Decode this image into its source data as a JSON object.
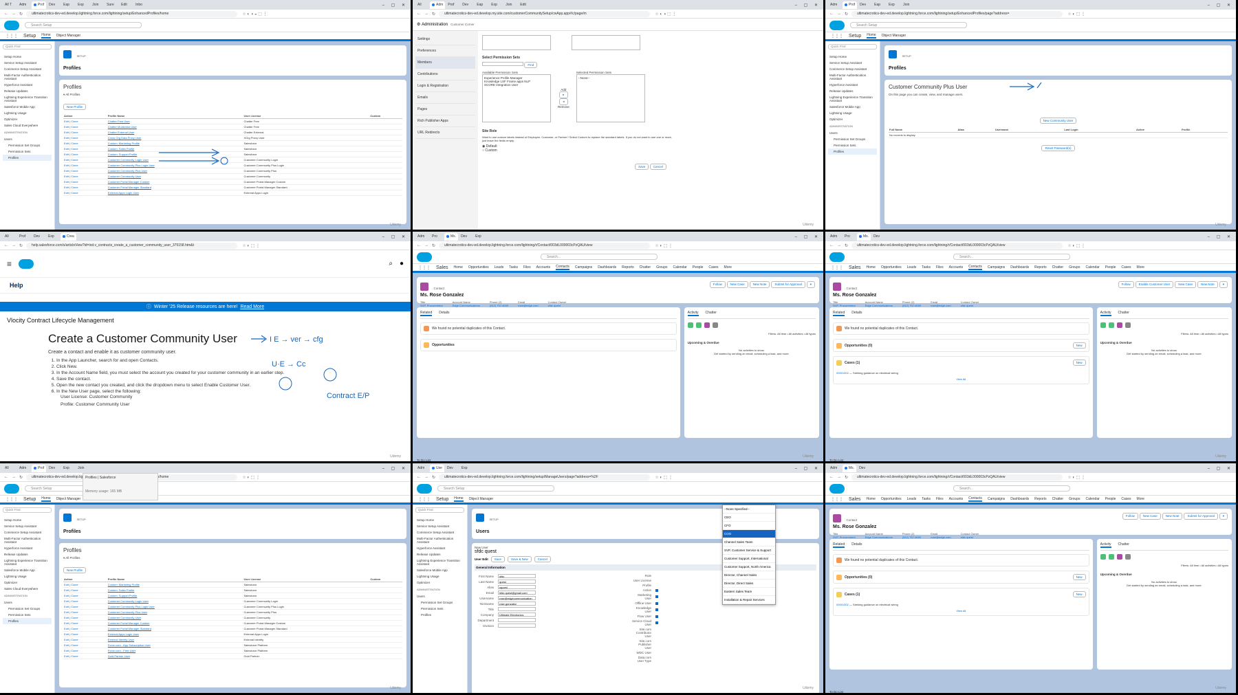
{
  "watermark": "Udemy",
  "cells": {
    "c1": {
      "url": "ultimatecrotics-dev-ed.develop.lightning.force.com/lightning/setup/EnhancedProfiles/home",
      "app": "Setup",
      "nav_home": "Home",
      "nav_object_manager": "Object Manager",
      "search_placeholder": "Search Setup",
      "quick_find": "Quick Find",
      "sidebar": [
        "Setup Home",
        "Service Setup Assistant",
        "Commerce Setup Assistant",
        "Multi-Factor Authentication Assistant",
        "Hyperforce Assistant",
        "Release Updates",
        "Lightning Experience Transition Assistant",
        "Salesforce Mobile App",
        "Lightning Usage",
        "Optimizer",
        "Sales Cloud Everywhere"
      ],
      "admin_heading": "ADMINISTRATION",
      "users_label": "Users",
      "sub_items": [
        "Permission Set Groups",
        "Permission Sets",
        "Profiles"
      ],
      "header_small": "SETUP",
      "header_title": "Profiles",
      "panel_title": "Profiles",
      "view_label": "All Profiles",
      "new_profile": "New Profile",
      "columns": [
        "Action",
        "Profile Name",
        "User License",
        "Custom"
      ],
      "rows": [
        [
          "Edit | Clone",
          "Chatter Free User",
          "Chatter Free"
        ],
        [
          "Edit | Clone",
          "Chatter Moderator User",
          "Chatter Free"
        ],
        [
          "Edit | Clone",
          "Chatter External User",
          "Chatter External"
        ],
        [
          "Edit | Clone",
          "Cross Org Data Proxy User",
          "XOrg Proxy User"
        ],
        [
          "Edit | Clone",
          "Custom: Marketing Profile",
          "Salesforce"
        ],
        [
          "Edit | Clone",
          "Custom: Sales Profile",
          "Salesforce"
        ],
        [
          "Edit | Clone",
          "Custom: Support Profile",
          "Salesforce"
        ],
        [
          "Edit | Clone",
          "Customer Community Login User",
          "Customer Community Login"
        ],
        [
          "Edit | Clone",
          "Customer Community Plus Login User",
          "Customer Community Plus Login"
        ],
        [
          "Edit | Clone",
          "Customer Community Plus User",
          "Customer Community Plus"
        ],
        [
          "Edit | Clone",
          "Customer Community User",
          "Customer Community"
        ],
        [
          "Edit | Clone",
          "Customer Portal Manager Custom",
          "Customer Portal Manager Custom"
        ],
        [
          "Edit | Clone",
          "Customer Portal Manager Standard",
          "Customer Portal Manager Standard"
        ],
        [
          "Edit | Clone",
          "External Apps Login User",
          "External Apps Login"
        ]
      ]
    },
    "c2": {
      "url": "ultimatecrotics-dev-ed.develop.my.site.com/customerCommunitySetup/cwApp.app#/c/page/m",
      "admin_title": "Administration",
      "admin_sub": "Customer Corner",
      "menu": [
        "Settings",
        "Preferences",
        "Members",
        "Contributions",
        "Login & Registration",
        "Emails",
        "Pages",
        "Rich Publisher Apps",
        "URL Redirects"
      ],
      "perm_title": "Select Permission Sets",
      "find_btn": "Find",
      "available_lbl": "Available Permission Sets",
      "selected_lbl": "Selected Permission Sets",
      "available_items": [
        "Experience Profile Manager",
        "Knowledge LSF Frame apps NLP",
        "SCORE Integration User"
      ],
      "selected_items": [
        "--None--"
      ],
      "add_lbl": "Add",
      "remove_lbl": "Remove",
      "site_role": "Site Role",
      "site_role_desc": "Want to use custom labels instead of Employee, Customer, or Partner? Select Custom to replace the standard labels. If you do not want to use one or more, just leave the fields empty.",
      "radio_default": "Default",
      "radio_custom": "Custom",
      "save": "Save",
      "cancel": "Cancel"
    },
    "c3": {
      "url": "ultimatecrotics-dev-ed.develop.lightning.force.com/lightning/setup/EnhancedProfiles/page?address=",
      "title": "Customer Community Plus User",
      "desc": "On this page you can create, view, and manage users.",
      "new_btn": "New Community User",
      "reset_btn": "Reset Password(s)",
      "cols": [
        "Full Name",
        "Alias",
        "Username",
        "Last Login",
        "Active",
        "Profile"
      ],
      "empty": "No records to display."
    },
    "c4": {
      "url": "help.salesforce.com/s/articleView?id=ind.v_contracts_create_a_customer_community_user_375158.htm&t",
      "help": "Help",
      "banner": "Winter '25 Release resources are here!",
      "banner_link": "Read More",
      "product": "Vlocity Contract Lifecycle Management",
      "title": "Create a Customer Community User",
      "intro": "Create a contact and enable it as customer community user.",
      "steps": [
        "In the App Launcher, search for and open Contacts.",
        "Click New.",
        "In the Account Name field, you must select the account you created for your customer community in an earlier step.",
        "Save the contact.",
        "Open the new contact you created, and click the dropdown menu to select Enable Customer User.",
        "In the New User page, select the following:"
      ],
      "license": "User License: Customer Community",
      "profile": "Profile: Customer Community User"
    },
    "c5": {
      "url": "ultimatecrotics-dev-ed.develop.lightning.force.com/lightning/r/Contact/003dL000003cPzQAU/view",
      "app": "Sales",
      "nav": [
        "Home",
        "Opportunities",
        "Leads",
        "Tasks",
        "Files",
        "Accounts",
        "Contacts",
        "Campaigns",
        "Dashboards",
        "Reports",
        "Chatter",
        "Groups",
        "Calendar",
        "People",
        "Cases",
        "More"
      ],
      "obj": "Contact",
      "name": "Ms. Rose Gonzalez",
      "fields": [
        [
          "Title",
          "SVP, Procurement"
        ],
        [
          "Account Name",
          "Edge Communications"
        ],
        [
          "Phone (2)",
          "(512) 757-6000"
        ],
        [
          "Email",
          "rose@edge.com"
        ],
        [
          "Contact Owner",
          "sfdc quest"
        ]
      ],
      "actions": [
        "Follow",
        "New Case",
        "New Note",
        "Submit for Approval"
      ],
      "related": "Related",
      "details": "Details",
      "dupes": "We found no potential duplicates of this Contact.",
      "opps": "Opportunities",
      "activity": "Activity",
      "chatter": "Chatter",
      "filters": "Filters: All time • All activities • All types",
      "upcoming": "Upcoming & Overdue",
      "no_act": "No activities to show.",
      "no_act2": "Get started by sending an email, scheduling a task, and more.",
      "footer": "To Do List"
    },
    "c6": {
      "name": "Ms. Rose Gonzalez",
      "actions": [
        "Follow",
        "Enable Customer User",
        "New Case",
        "New Note"
      ],
      "opps": "Opportunities (0)",
      "cases": "Cases (1)",
      "case_num": "00001002",
      "case_subject": "Seeking guidance on electrical wiring",
      "view_all": "View All",
      "new_btn": "New"
    },
    "c7": {
      "tooltip": "Profiles | Salesforce",
      "memory": "Memory usage: 165 MB",
      "rows": [
        [
          "Edit | Clone",
          "Custom: Marketing Profile",
          "Salesforce"
        ],
        [
          "Edit | Clone",
          "Custom: Sales Profile",
          "Salesforce"
        ],
        [
          "Edit | Clone",
          "Custom: Support Profile",
          "Salesforce"
        ],
        [
          "Edit | Clone",
          "Customer Community Login User",
          "Customer Community Login"
        ],
        [
          "Edit | Clone",
          "Customer Community Plus Login User",
          "Customer Community Plus Login"
        ],
        [
          "Edit | Clone",
          "Customer Community Plus User",
          "Customer Community Plus"
        ],
        [
          "Edit | Clone",
          "Customer Community User",
          "Customer Community"
        ],
        [
          "Edit | Clone",
          "Customer Portal Manager Custom",
          "Customer Portal Manager Custom"
        ],
        [
          "Edit | Clone",
          "Customer Portal Manager Standard",
          "Customer Portal Manager Standard"
        ],
        [
          "Edit | Clone",
          "External Apps Login User",
          "External Apps Login"
        ],
        [
          "Edit | Clone",
          "External Identity User",
          "External Identity"
        ],
        [
          "Edit | Clone",
          "Force.com - App Subscription User",
          "Salesforce Platform"
        ],
        [
          "Edit | Clone",
          "Force.com - Free User",
          "Salesforce Platform"
        ],
        [
          "Edit | Clone",
          "Gold Partner User",
          "Gold Partner"
        ]
      ]
    },
    "c8": {
      "url": "ultimatecrotics-dev-ed.develop.lightning.force.com/lightning/setup/ManageUsers/page?address=%2F",
      "header_small": "SETUP",
      "header_title": "Users",
      "user_lbl": "New User",
      "user_name": "sfdc quest",
      "edit_title": "User Edit",
      "save": "Save",
      "save_new": "Save & New",
      "cancel": "Cancel",
      "gen_info": "General Information",
      "form": [
        [
          "First Name",
          "sfdc"
        ],
        [
          "Last Name",
          "quest"
        ],
        [
          "Alias",
          "squest"
        ],
        [
          "Email",
          "sfdc.quest@gmail.com"
        ],
        [
          "Username",
          "rose@edgecommunication"
        ],
        [
          "Nickname",
          "rose.gonzalez"
        ],
        [
          "Title",
          ""
        ],
        [
          "Company",
          "Ultimate Electronics"
        ],
        [
          "Department",
          ""
        ],
        [
          "Division",
          ""
        ]
      ],
      "role_options": [
        "--None Specified--",
        "CEO",
        "CFO",
        "COO",
        "Channel Sales Team",
        "SVP, Customer Service & Support",
        "Customer Support, International",
        "Customer Support, North America",
        "Director, Channel Sales",
        "Director, Direct Sales",
        "Eastern Sales Team",
        "Installation & Repair Services"
      ],
      "highlight": "COO",
      "right_labels": [
        "Role",
        "User License",
        "Profile",
        "Active",
        "Marketing User",
        "Offline User",
        "Knowledge User",
        "Flow User",
        "Service Cloud User",
        "Site.com Contributor User",
        "Site.com Publisher User",
        "WDC User",
        "Data.com User Type"
      ]
    },
    "c9": {
      "name": "Ms. Rose Gonzalez",
      "actions": [
        "Follow",
        "New Case",
        "New Note",
        "Submit for Approval"
      ]
    }
  }
}
